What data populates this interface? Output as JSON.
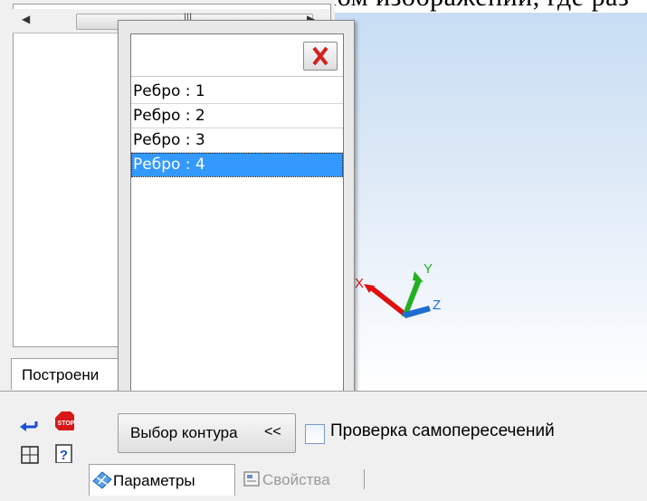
{
  "document": {
    "top_text": "дкружающие в прямоугольном изображении, где раз"
  },
  "tree_panel": {
    "scroll_glyph": "III",
    "tab_label": "Построени"
  },
  "popup": {
    "close_label": "Close",
    "items": [
      {
        "label": "Ребро : 1"
      },
      {
        "label": "Ребро : 2"
      },
      {
        "label": "Ребро : 3"
      },
      {
        "label": "Ребро : 4",
        "selected": true
      }
    ]
  },
  "axes": {
    "x": "X",
    "y": "Y",
    "z": "Z"
  },
  "bottom": {
    "contour_button": "Выбор контура",
    "contour_chevron": "<<",
    "self_intersection_label": "Проверка самопересечений",
    "self_intersection_checked": false,
    "tabs": [
      {
        "label": "Параметры",
        "active": true
      },
      {
        "label": "Свойства",
        "active": false
      }
    ]
  },
  "colors": {
    "selection": "#3399ff",
    "axis_x": "#e01010",
    "axis_y": "#22b022",
    "axis_z": "#1e6fd0",
    "close_x": "#d42020"
  }
}
